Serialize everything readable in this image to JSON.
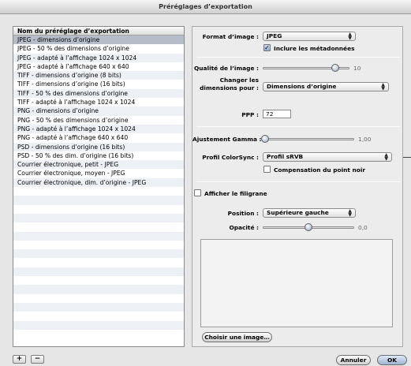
{
  "window": {
    "title": "Préréglages d’exportation"
  },
  "presets": {
    "header": "Nom du préréglage d’exportation",
    "items": [
      "JPEG - dimensions d’origine",
      "JPEG - 50 % des dimensions d’origine",
      "JPEG - adapté à l’affichage 1024 x 1024",
      "JPEG - adapté à l’affichage 640 x 640",
      "TIFF - dimensions d’origine (8 bits)",
      "TIFF - dimensions d’origine (16 bits)",
      "TIFF - 50 % des dimensions d’origine",
      "TIFF - adapté à l’affichage 1024 x 1024",
      "PNG - dimensions d’origine",
      "PNG - 50 % des dimensions d’origine",
      "PNG - adapté à l’affichage 1024 x 1024",
      "PNG - adapté à l’affichage 640 x 640",
      "PSD - dimensions d’origine (16 bits)",
      "PSD - 50 % des dim. d’origine (16 bits)",
      "Courrier électronique, petit - JPEG",
      "Courrier électronique, moyen - JPEG",
      "Courrier électronique, dim. d’origine - JPEG"
    ],
    "selected_index": 0,
    "add_label": "+",
    "remove_label": "−"
  },
  "settings": {
    "format_label": "Format d’image :",
    "format_value": "JPEG",
    "include_metadata_label": "Inclure les métadonnées",
    "include_metadata_checked": true,
    "quality_label": "Qualité de l’image :",
    "quality_value": "10",
    "quality_level": 10,
    "quality_max": 12,
    "resize_label_line1": "Changer les",
    "resize_label_line2": "dimensions pour :",
    "resize_value": "Dimensions d’origine",
    "dpi_label": "PPP :",
    "dpi_value": "72",
    "gamma_label": "Ajustement Gamma :",
    "gamma_value": "1,00",
    "colorsync_label": "Profil ColorSync :",
    "colorsync_value": "Profil sRVB",
    "black_point_label": "Compensation du point noir",
    "black_point_checked": false,
    "watermark_label": "Afficher le filigrane",
    "watermark_checked": false,
    "position_label": "Position :",
    "position_value": "Supérieure gauche",
    "opacity_label": "Opacité :",
    "opacity_value": "0,0",
    "choose_image_label": "Choisir une image…"
  },
  "footer": {
    "cancel_label": "Annuler",
    "ok_label": "OK"
  }
}
